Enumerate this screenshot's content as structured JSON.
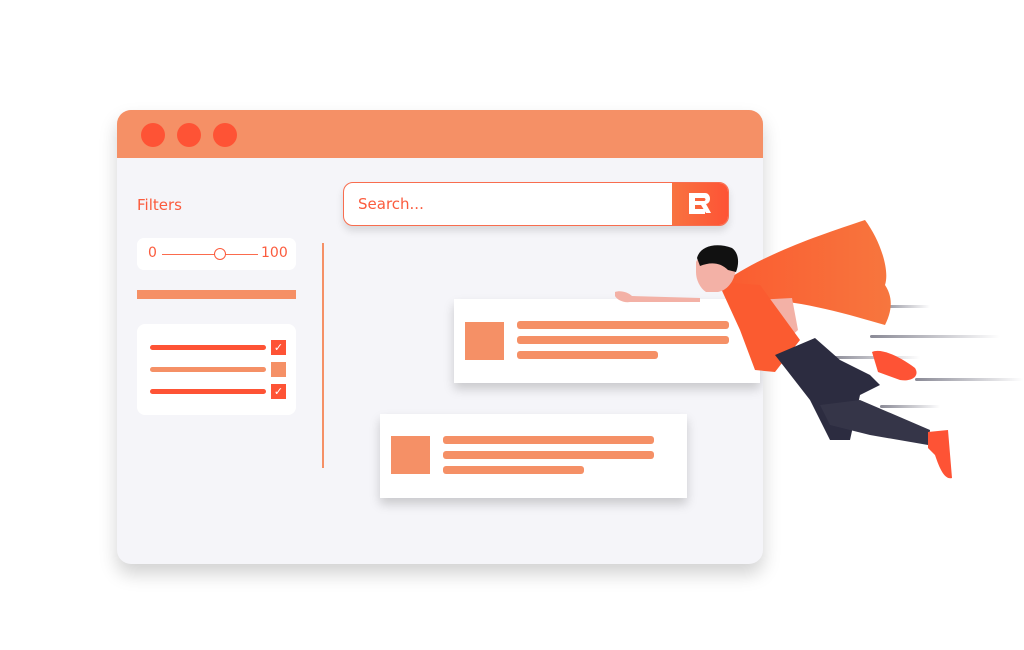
{
  "window": {
    "controls": [
      "close",
      "minimize",
      "maximize"
    ],
    "colors": {
      "titlebar": "#f59066",
      "dots": "#fe5335",
      "accent": "#fb5b3d",
      "background": "#f5f5f9"
    }
  },
  "sidebar": {
    "title": "Filters",
    "range": {
      "min_label": "0",
      "max_label": "100",
      "value_fraction": 0.6
    },
    "checklist": [
      {
        "checked": true,
        "check_glyph": "✓"
      },
      {
        "checked": false,
        "check_glyph": ""
      },
      {
        "checked": true,
        "check_glyph": "✓"
      }
    ]
  },
  "search": {
    "placeholder": "Search...",
    "value": "",
    "button_icon": "brand-logo-icon"
  },
  "results": [
    {
      "lines": 3
    },
    {
      "lines": 3
    }
  ],
  "illustration": {
    "subject": "flying superhero with orange cape",
    "colors": {
      "cape": "#f86d3c",
      "pants": "#2c2c40",
      "shoes": "#fe5335",
      "skin": "#f3b1a6",
      "hair": "#111111"
    }
  }
}
